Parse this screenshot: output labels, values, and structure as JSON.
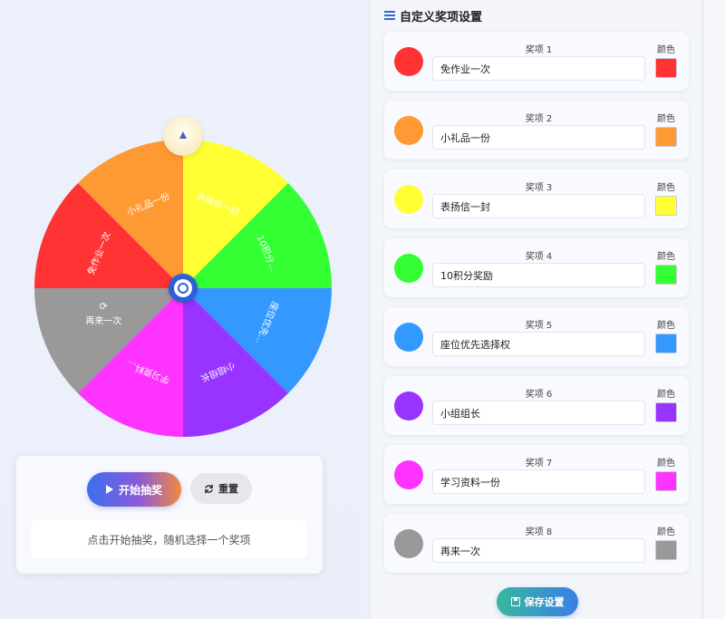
{
  "wheel": {
    "slices": [
      {
        "label": "免作业一次",
        "color": "#ff3333"
      },
      {
        "label": "小礼品一份",
        "color": "#ff9933"
      },
      {
        "label": "表扬信一封",
        "color": "#ffff33"
      },
      {
        "label": "10积分…",
        "color": "#33ff33"
      },
      {
        "label": "座位优先…",
        "color": "#3399ff"
      },
      {
        "label": "小组组长",
        "color": "#9933ff"
      },
      {
        "label": "学习资料…",
        "color": "#ff33ff"
      },
      {
        "label": "再来一次",
        "color": "#999999"
      }
    ],
    "retry_icon": "refresh-icon"
  },
  "controls": {
    "start_label": "开始抽奖",
    "reset_label": "重置",
    "hint": "点击开始抽奖，随机选择一个奖项"
  },
  "panel": {
    "title": "自定义奖项设置",
    "color_label": "颜色",
    "save_label": "保存设置",
    "prizes": [
      {
        "label": "奖项 1",
        "value": "免作业一次",
        "color": "#ff3333"
      },
      {
        "label": "奖项 2",
        "value": "小礼品一份",
        "color": "#ff9933"
      },
      {
        "label": "奖项 3",
        "value": "表扬信一封",
        "color": "#ffff33"
      },
      {
        "label": "奖项 4",
        "value": "10积分奖励",
        "color": "#33ff33"
      },
      {
        "label": "奖项 5",
        "value": "座位优先选择权",
        "color": "#3399ff"
      },
      {
        "label": "奖项 6",
        "value": "小组组长",
        "color": "#9933ff"
      },
      {
        "label": "奖项 7",
        "value": "学习资料一份",
        "color": "#ff33ff"
      },
      {
        "label": "奖项 8",
        "value": "再来一次",
        "color": "#999999"
      }
    ]
  }
}
